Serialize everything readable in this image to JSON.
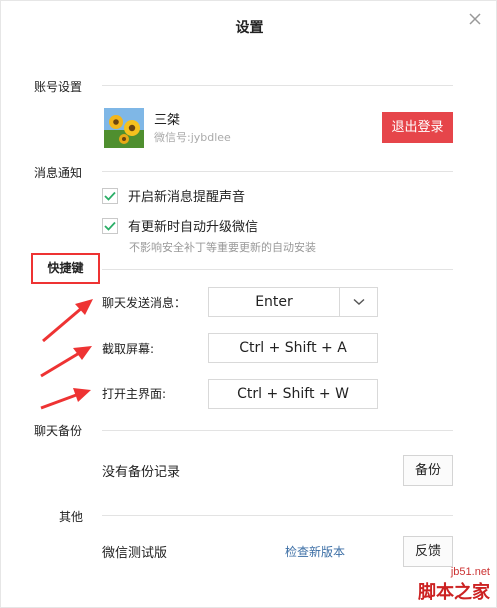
{
  "window": {
    "title": "设置"
  },
  "account": {
    "section_label": "账号设置",
    "nickname": "三桀",
    "wechat_id": "微信号:jybdlee",
    "logout_label": "退出登录"
  },
  "notify": {
    "section_label": "消息通知",
    "options": [
      {
        "label": "开启新消息提醒声音",
        "checked": true
      },
      {
        "label": "有更新时自动升级微信",
        "checked": true
      }
    ],
    "hint": "不影响安全补丁等重要更新的自动安装"
  },
  "shortcuts": {
    "section_label": "快捷键",
    "items": [
      {
        "label": "聊天发送消息：",
        "value": "Enter"
      },
      {
        "label": "截取屏幕:",
        "value": "Ctrl + Shift + A"
      },
      {
        "label": "打开主界面:",
        "value": "Ctrl + Shift + W"
      }
    ]
  },
  "backup": {
    "section_label": "聊天备份",
    "status": "没有备份记录",
    "backup_label": "备份"
  },
  "other": {
    "section_label": "其他",
    "version_label": "微信测试版",
    "check_update_label": "检查新版本",
    "feedback_label": "反馈"
  },
  "watermark": {
    "url": "jb51.net",
    "name": "脚本之家"
  },
  "colors": {
    "logout_bg": "#e6454a",
    "check_green": "#2aae67",
    "annotation_red": "#e33333",
    "link_blue": "#3b6ea5"
  }
}
